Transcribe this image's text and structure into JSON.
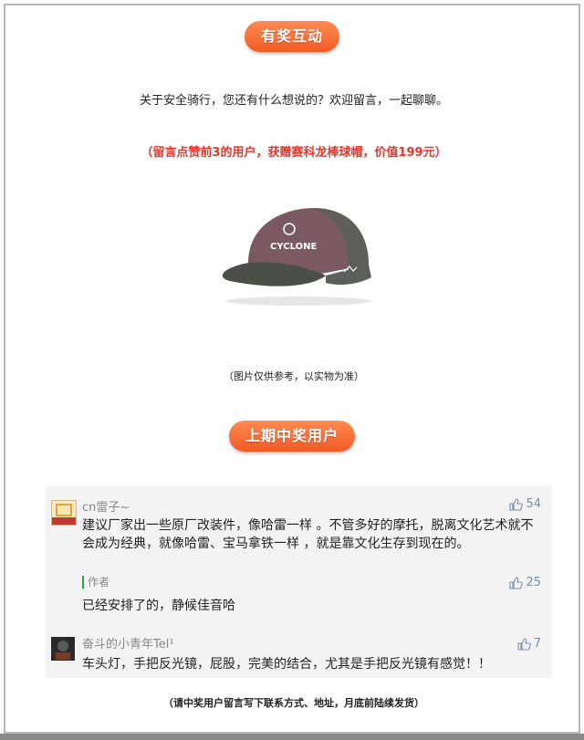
{
  "section1_title": "有奖互动",
  "intro_text": "关于安全骑行，您还有什么想说的？欢迎留言，一起聊聊。",
  "promo_text": "（留言点赞前3的用户，获赠赛科龙棒球帽，价值199元）",
  "product_image": {
    "brand_text": "CYCLONE",
    "caption": "（图片仅供参考，以实物为准）"
  },
  "section2_title": "上期中奖用户",
  "comments": [
    {
      "username": "cn雷子~",
      "likes": "54",
      "text": "建议厂家出一些原厂改装件，像哈雷一样 。不管多好的摩托，脱离文化艺术就不会成为经典，就像哈雷、宝马拿铁一样 ，就是靠文化生存到现在的。",
      "reply": {
        "author": "作者",
        "likes": "25",
        "text": "已经安排了的，静候佳音哈"
      }
    },
    {
      "username": "奋斗的小青年Tel¹",
      "likes": "7",
      "text": "车头灯，手把反光镜，屁股，完美的结合，尤其是手把反光镜有感觉！！"
    }
  ],
  "footer_text": "（请中奖用户留言写下联系方式、地址，月底前陆续发货）"
}
